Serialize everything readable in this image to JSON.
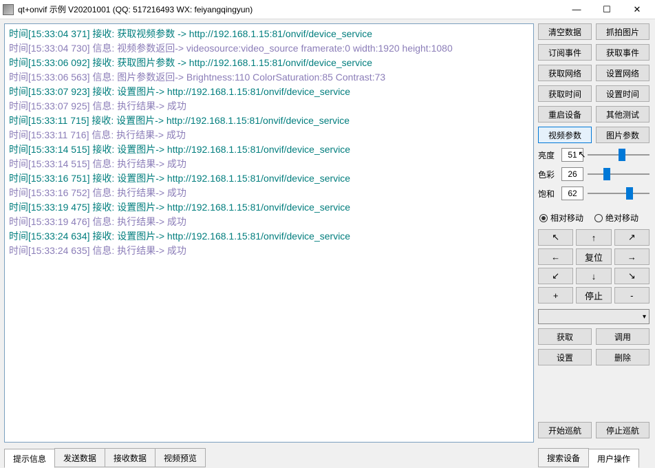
{
  "window": {
    "title": "qt+onvif 示例 V20201001 (QQ: 517216493 WX: feiyangqingyun)"
  },
  "log_lines": [
    {
      "type": "recv",
      "text": "时间[15:33:04 371] 接收: 获取视频参数 -> http://192.168.1.15:81/onvif/device_service"
    },
    {
      "type": "info",
      "text": "时间[15:33:04 730] 信息: 视频参数返回-> videosource:video_source  framerate:0  width:1920  height:1080"
    },
    {
      "type": "recv",
      "text": "时间[15:33:06 092] 接收: 获取图片参数 -> http://192.168.1.15:81/onvif/device_service"
    },
    {
      "type": "info",
      "text": "时间[15:33:06 563] 信息: 图片参数返回-> Brightness:110  ColorSaturation:85  Contrast:73"
    },
    {
      "type": "recv",
      "text": "时间[15:33:07 923] 接收: 设置图片-> http://192.168.1.15:81/onvif/device_service"
    },
    {
      "type": "info",
      "text": "时间[15:33:07 925] 信息: 执行结果-> 成功"
    },
    {
      "type": "recv",
      "text": "时间[15:33:11 715] 接收: 设置图片-> http://192.168.1.15:81/onvif/device_service"
    },
    {
      "type": "info",
      "text": "时间[15:33:11 716] 信息: 执行结果-> 成功"
    },
    {
      "type": "recv",
      "text": "时间[15:33:14 515] 接收: 设置图片-> http://192.168.1.15:81/onvif/device_service"
    },
    {
      "type": "info",
      "text": "时间[15:33:14 515] 信息: 执行结果-> 成功"
    },
    {
      "type": "recv",
      "text": "时间[15:33:16 751] 接收: 设置图片-> http://192.168.1.15:81/onvif/device_service"
    },
    {
      "type": "info",
      "text": "时间[15:33:16 752] 信息: 执行结果-> 成功"
    },
    {
      "type": "recv",
      "text": "时间[15:33:19 475] 接收: 设置图片-> http://192.168.1.15:81/onvif/device_service"
    },
    {
      "type": "info",
      "text": "时间[15:33:19 476] 信息: 执行结果-> 成功"
    },
    {
      "type": "recv",
      "text": "时间[15:33:24 634] 接收: 设置图片-> http://192.168.1.15:81/onvif/device_service"
    },
    {
      "type": "info",
      "text": "时间[15:33:24 635] 信息: 执行结果-> 成功"
    }
  ],
  "bottom_tabs": [
    "提示信息",
    "发送数据",
    "接收数据",
    "视频预览"
  ],
  "right_tabs": [
    "搜索设备",
    "用户操作"
  ],
  "buttons": {
    "clear_data": "清空数据",
    "snap_image": "抓拍图片",
    "sub_event": "订阅事件",
    "get_event": "获取事件",
    "get_net": "获取网络",
    "set_net": "设置网络",
    "get_time": "获取时间",
    "set_time": "设置时间",
    "reboot": "重启设备",
    "other_test": "其他测试",
    "video_param": "视频参数",
    "image_param": "图片参数",
    "get": "获取",
    "call": "调用",
    "set": "设置",
    "del": "删除",
    "start_patrol": "开始巡航",
    "stop_patrol": "停止巡航"
  },
  "sliders": {
    "brightness": {
      "label": "亮度",
      "value": "51",
      "pos": 50
    },
    "color": {
      "label": "色彩",
      "value": "26",
      "pos": 26
    },
    "saturation": {
      "label": "饱和",
      "value": "62",
      "pos": 62
    }
  },
  "radios": {
    "relative": "相对移动",
    "absolute": "绝对移动",
    "selected": "relative"
  },
  "ptz": {
    "reset": "复位",
    "stop": "停止",
    "plus": "+",
    "minus": "-"
  }
}
